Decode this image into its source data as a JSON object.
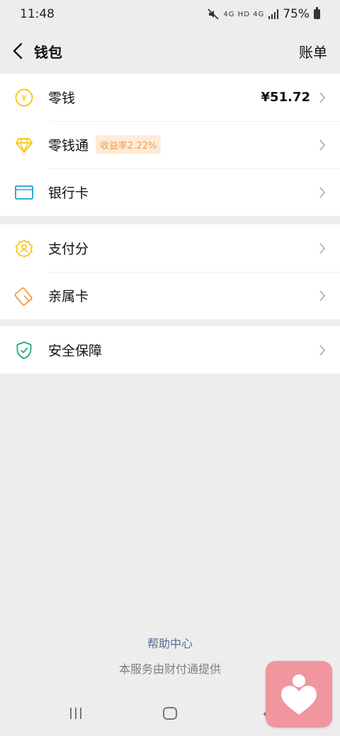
{
  "status_bar": {
    "time": "11:48",
    "network": "4G HD 4G",
    "battery": "75%"
  },
  "nav": {
    "title": "钱包",
    "right_action": "账单"
  },
  "groups": [
    {
      "items": [
        {
          "label": "零钱",
          "value": "¥51.72",
          "icon": "coin-icon"
        },
        {
          "label": "零钱通",
          "badge": "收益率2.22%",
          "icon": "diamond-icon"
        },
        {
          "label": "银行卡",
          "icon": "bank-card-icon"
        }
      ]
    },
    {
      "items": [
        {
          "label": "支付分",
          "icon": "score-badge-icon"
        },
        {
          "label": "亲属卡",
          "icon": "family-card-icon"
        }
      ]
    },
    {
      "items": [
        {
          "label": "安全保障",
          "icon": "security-shield-icon"
        }
      ]
    }
  ],
  "footer": {
    "help": "帮助中心",
    "provider": "本服务由财付通提供"
  },
  "colors": {
    "accent_yellow": "#f5c400",
    "card_blue": "#19a3d6",
    "family_orange": "#f39a45",
    "security_green": "#1aad6e",
    "badge_bg": "#fdecd9",
    "badge_text": "#ef9d46",
    "link_blue": "#576b95",
    "floating_app_bg": "#f1959f"
  }
}
